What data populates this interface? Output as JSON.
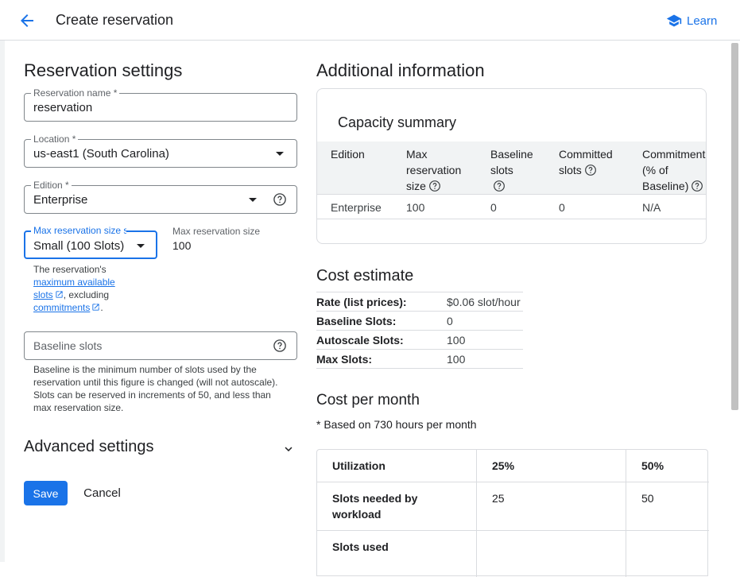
{
  "header": {
    "title": "Create reservation",
    "learn_label": "Learn"
  },
  "reservation_settings": {
    "heading": "Reservation settings",
    "name_field": {
      "label": "Reservation name *",
      "value": "reservation"
    },
    "location_field": {
      "label": "Location *",
      "value": "us-east1 (South Carolina)"
    },
    "edition_field": {
      "label": "Edition *",
      "value": "Enterprise"
    },
    "max_size_select": {
      "label": "Max reservation size selector",
      "value": "Small (100 Slots)"
    },
    "max_size_readout": {
      "label": "Max reservation size",
      "value": "100"
    },
    "max_size_help": {
      "prefix": "The reservation's",
      "link1": "maximum available slots",
      "middle": ", excluding",
      "link2": "commitments",
      "suffix": "."
    },
    "baseline_field": {
      "placeholder": "Baseline slots"
    },
    "baseline_help": "Baseline is the minimum number of slots used by the reservation until this figure is changed (will not autoscale). Slots can be reserved in increments of 50, and less than max reservation size.",
    "advanced_label": "Advanced settings",
    "save_label": "Save",
    "cancel_label": "Cancel"
  },
  "additional_info": {
    "heading": "Additional information",
    "capacity_summary": {
      "title": "Capacity summary",
      "headers": {
        "edition": "Edition",
        "max_size_line1": "Max",
        "max_size_line2": "reservation",
        "max_size_line3": "size",
        "baseline_line1": "Baseline",
        "baseline_line2": "slots",
        "committed_line1": "Committed",
        "committed_line2": "slots",
        "commitment_line1": "Commitment",
        "commitment_line2": "(% of",
        "commitment_line3": "Baseline)"
      },
      "row": {
        "edition": "Enterprise",
        "max_size": "100",
        "baseline": "0",
        "committed": "0",
        "commitment": "N/A"
      }
    },
    "cost_estimate": {
      "heading": "Cost estimate",
      "rows": [
        {
          "label": "Rate (list prices):",
          "value": "$0.06 slot/hour"
        },
        {
          "label": "Baseline Slots:",
          "value": "0"
        },
        {
          "label": "Autoscale Slots:",
          "value": "100"
        },
        {
          "label": "Max Slots:",
          "value": "100"
        }
      ]
    },
    "cost_per_month": {
      "heading": "Cost per month",
      "note": "* Based on 730 hours per month",
      "utilization_label": "Utilization",
      "col_25": "25%",
      "col_50": "50%",
      "slots_needed_line1": "Slots needed by",
      "slots_needed_line2": "workload",
      "slots_needed_25": "25",
      "slots_needed_50": "50",
      "slots_used_label": "Slots used"
    }
  },
  "colors": {
    "accent": "#1a73e8",
    "border": "#dadce0",
    "table_header_bg": "#f1f3f4"
  }
}
